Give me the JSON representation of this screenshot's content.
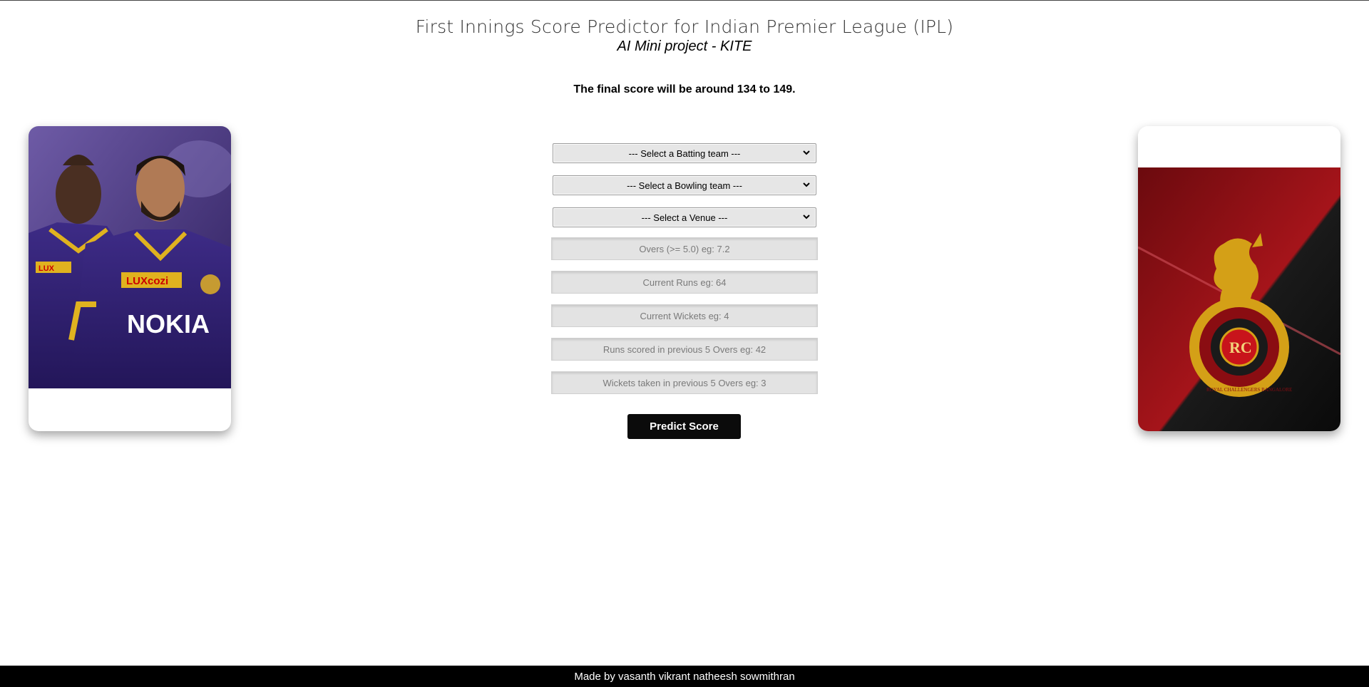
{
  "header": {
    "title": "First Innings Score Predictor for Indian Premier League (IPL)",
    "subtitle": "AI Mini project - KITE"
  },
  "result_text": "The final score will be around 134 to 149.",
  "form": {
    "batting_select": "--- Select a Batting team ---",
    "bowling_select": "--- Select a Bowling team ---",
    "venue_select": "--- Select a Venue ---",
    "overs_placeholder": "Overs (>= 5.0) eg: 7.2",
    "runs_placeholder": "Current Runs eg: 64",
    "wickets_placeholder": "Current Wickets eg: 4",
    "runs_last5_placeholder": "Runs scored in previous 5 Overs eg: 42",
    "wickets_last5_placeholder": "Wickets taken in previous 5 Overs eg: 3",
    "predict_label": "Predict Score"
  },
  "images": {
    "left_card": {
      "icon": "kkr-players-image",
      "jersey_sponsor": "NOKIA",
      "jersey_logo": "LUXcozi"
    },
    "right_card": {
      "icon": "rcb-logo-image",
      "crest_letters": "RC",
      "ring_text": "ROYAL CHALLENGERS BANGALORE"
    }
  },
  "colors": {
    "accent_button": "#0b0b0b",
    "footer_bg": "#000000",
    "kkr_purple": "#3b2a78",
    "rcb_red": "#8a0d12",
    "rcb_gold": "#d4a017"
  },
  "footer": {
    "credits": "Made by vasanth vikrant natheesh sowmithran"
  }
}
